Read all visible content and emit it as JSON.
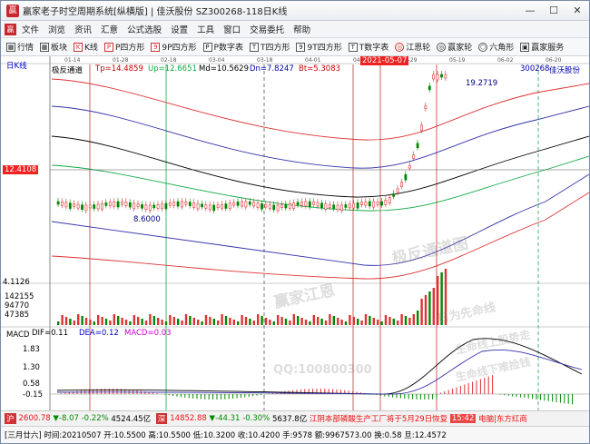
{
  "window": {
    "title": "赢家老子时空周期系统[纵横版] | 佳沃股份  SZ300268-118日K线",
    "min": "—",
    "max": "☐",
    "close": "✕"
  },
  "menu": [
    "文件",
    "浏览",
    "资讯",
    "汇意",
    "公式选股",
    "设置",
    "工具",
    "窗口",
    "交易委托",
    "帮助"
  ],
  "toolbar": [
    {
      "label": "行情",
      "icon": "grid-icon"
    },
    {
      "label": "板块",
      "icon": "grid-icon"
    },
    {
      "label": "K线",
      "icon": "candle-icon"
    },
    {
      "label": "P四方形",
      "icon": "square-icon"
    },
    {
      "label": "9P四方形",
      "icon": "square-icon"
    },
    {
      "label": "P数字表",
      "icon": "table-icon"
    },
    {
      "label": "T四方形",
      "icon": "square-icon"
    },
    {
      "label": "9T四方形",
      "icon": "square-icon"
    },
    {
      "label": "T数字表",
      "icon": "table-icon"
    },
    {
      "label": "江恩轮",
      "icon": "wheel-icon"
    },
    {
      "label": "赢家轮",
      "icon": "wheel-icon"
    },
    {
      "label": "六角形",
      "icon": "hexagon-icon"
    },
    {
      "label": "赢家服务",
      "icon": "service-icon"
    }
  ],
  "chart_header": {
    "period": "日K线",
    "indicator": "极反通道",
    "tp": "Tp=14.4859",
    "up": "Up=12.6651",
    "md": "Md=10.5629",
    "dn": "Dn=7.8247",
    "bt": "Bt=5.3083",
    "code": "300268",
    "name": "佳沃股份",
    "date_tag": "2021-05-07"
  },
  "dates": [
    "01-14",
    "01-28",
    "02-18",
    "03-04",
    "03-18",
    "04-01",
    "04-15",
    "04-29",
    "05-19",
    "06-02",
    "06-20"
  ],
  "price_labels": {
    "left_price": "12.4108",
    "low": "8.6000",
    "high": "19.2719",
    "bottom_price": "4.1126"
  },
  "volume_labels": [
    "142155",
    "94770",
    "47385"
  ],
  "macd_header": {
    "name": "MACD",
    "dif": "DIF=0.11",
    "dea": "DEA=0.12",
    "macd": "MACD=0.03"
  },
  "macd_ticks": [
    "1.83",
    "1.30",
    "0.58",
    "-0.15"
  ],
  "watermarks": [
    "赢家江恩",
    "极反通道图",
    "日为先命线",
    "生命线上股势走",
    "QQ:100800300",
    "生命线下难捡钱"
  ],
  "status": {
    "session": "[三月廿六]",
    "idx1_val": "2600.78",
    "idx1_chg": "▼-8.07",
    "idx1_pct": "-0.22%",
    "idx1_amt": "4524.45亿",
    "idx2_val": "14852.88",
    "idx2_chg": "▼-44.31",
    "idx2_pct": "-0.30%",
    "idx2_amt": "5637.8亿",
    "news": "江阴本部磷酸生产工厂将于5月29日恢复",
    "time": "15:42",
    "news2": "电脑|东方红商"
  },
  "info": {
    "time": "时间:20210507",
    "open": "开:10.5500",
    "high": "高:10.5500",
    "low": "低:10.3200",
    "close": "收:10.4200",
    "hand": "手:9578",
    "amount": "额:9967573.00",
    "turnover": "换:0.58",
    "price": "旦:12.4572"
  }
}
